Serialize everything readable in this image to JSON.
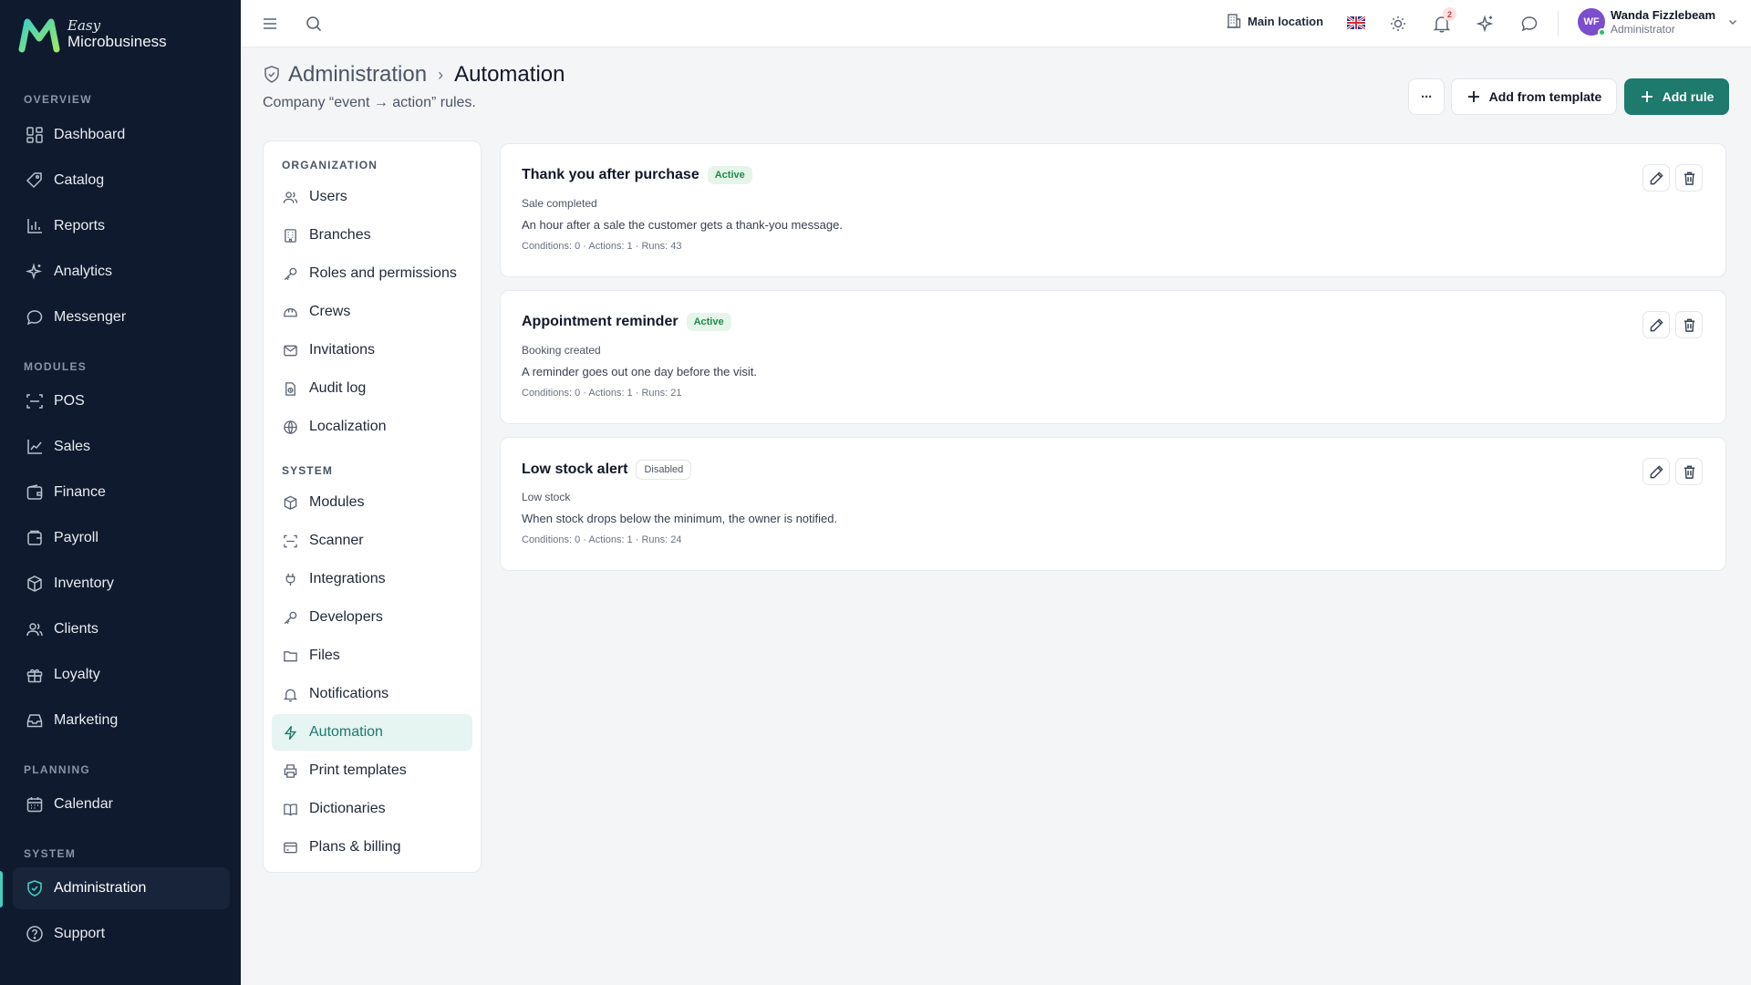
{
  "app": {
    "easy": "Easy",
    "name": "Microbusiness"
  },
  "sidebar": {
    "sections": [
      "OVERVIEW",
      "MODULES",
      "PLANNING",
      "SYSTEM"
    ],
    "items": [
      {
        "label": "Dashboard",
        "icon": "dashboard-icon"
      },
      {
        "label": "Catalog",
        "icon": "tag-icon"
      },
      {
        "label": "Reports",
        "icon": "bar-chart-icon"
      },
      {
        "label": "Analytics",
        "icon": "sparkles-icon"
      },
      {
        "label": "Messenger",
        "icon": "chat-icon"
      },
      {
        "label": "POS",
        "icon": "scan-icon"
      },
      {
        "label": "Sales",
        "icon": "line-chart-icon"
      },
      {
        "label": "Finance",
        "icon": "wallet-icon"
      },
      {
        "label": "Payroll",
        "icon": "payroll-icon"
      },
      {
        "label": "Inventory",
        "icon": "box-icon"
      },
      {
        "label": "Clients",
        "icon": "users-icon"
      },
      {
        "label": "Loyalty",
        "icon": "gift-icon"
      },
      {
        "label": "Marketing",
        "icon": "inbox-icon"
      },
      {
        "label": "Calendar",
        "icon": "calendar-icon"
      },
      {
        "label": "Administration",
        "icon": "shield-icon",
        "active": true
      },
      {
        "label": "Support",
        "icon": "help-icon"
      }
    ]
  },
  "topbar": {
    "location": "Main location",
    "notifications_count": "2",
    "user": {
      "initials": "WF",
      "name": "Wanda Fizzlebeam",
      "role": "Administrator"
    }
  },
  "header": {
    "breadcrumb_parent": "Administration",
    "breadcrumb_sep": "›",
    "title": "Automation",
    "subtitle": "Company “event → action” rules.",
    "more_label": "···",
    "add_template_label": "Add from template",
    "add_rule_label": "Add rule"
  },
  "settings_nav": {
    "sections": [
      "ORGANIZATION",
      "SYSTEM"
    ],
    "items": [
      {
        "label": "Users",
        "icon": "users-icon"
      },
      {
        "label": "Branches",
        "icon": "building-icon"
      },
      {
        "label": "Roles and permissions",
        "icon": "key-icon"
      },
      {
        "label": "Crews",
        "icon": "helmet-icon"
      },
      {
        "label": "Invitations",
        "icon": "mail-icon"
      },
      {
        "label": "Audit log",
        "icon": "audit-icon"
      },
      {
        "label": "Localization",
        "icon": "globe-icon"
      },
      {
        "label": "Modules",
        "icon": "box-icon"
      },
      {
        "label": "Scanner",
        "icon": "scan-icon"
      },
      {
        "label": "Integrations",
        "icon": "plug-icon"
      },
      {
        "label": "Developers",
        "icon": "key-icon"
      },
      {
        "label": "Files",
        "icon": "folder-icon"
      },
      {
        "label": "Notifications",
        "icon": "bell-icon"
      },
      {
        "label": "Automation",
        "icon": "bolt-icon",
        "active": true
      },
      {
        "label": "Print templates",
        "icon": "printer-icon"
      },
      {
        "label": "Dictionaries",
        "icon": "book-icon"
      },
      {
        "label": "Plans & billing",
        "icon": "card-icon"
      }
    ]
  },
  "rules": [
    {
      "title": "Thank you after purchase",
      "status": "Active",
      "trigger": "Sale completed",
      "description": "An hour after a sale the customer gets a thank-you message.",
      "stats": "Conditions: 0 · Actions: 1 · Runs: 43"
    },
    {
      "title": "Appointment reminder",
      "status": "Active",
      "trigger": "Booking created",
      "description": "A reminder goes out one day before the visit.",
      "stats": "Conditions: 0 · Actions: 1 · Runs: 21"
    },
    {
      "title": "Low stock alert",
      "status": "Disabled",
      "trigger": "Low stock",
      "description": "When stock drops below the minimum, the owner is notified.",
      "stats": "Conditions: 0 · Actions: 1 · Runs: 24"
    }
  ],
  "colors": {
    "sidebar_bg": "#0f1a2e",
    "accent": "#1d7a6d",
    "active_badge": "#1f8a4c"
  }
}
